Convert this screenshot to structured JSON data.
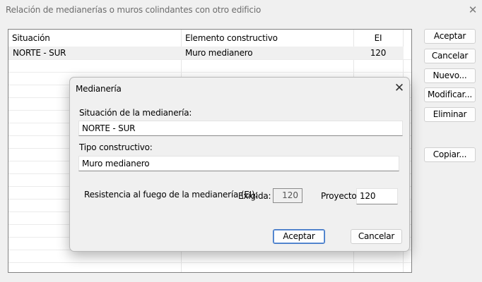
{
  "window": {
    "title": "Relación de medianerías o muros colindantes con otro edificio",
    "close_glyph": "✕"
  },
  "table": {
    "headers": {
      "situacion": "Situación",
      "elemento": "Elemento constructivo",
      "ei": "EI"
    },
    "rows": [
      {
        "situacion": "NORTE - SUR",
        "elemento": "Muro medianero",
        "ei": "120"
      }
    ]
  },
  "buttons": {
    "aceptar": "Aceptar",
    "cancelar": "Cancelar",
    "nuevo": "Nuevo...",
    "modificar": "Modificar...",
    "eliminar": "Eliminar",
    "copiar": "Copiar..."
  },
  "dialog": {
    "title": "Medianería",
    "close_glyph": "✕",
    "situacion_label": "Situación de la medianería:",
    "situacion_value": "NORTE - SUR",
    "tipo_label": "Tipo constructivo:",
    "tipo_value": "Muro medianero",
    "resistencia_label": "Resistencia al fuego de la medianería (EI):",
    "exigida_label": "Exigida:",
    "exigida_value": "120",
    "proyecto_label": "Proyecto:",
    "proyecto_value": "120",
    "aceptar": "Aceptar",
    "cancelar": "Cancelar"
  }
}
